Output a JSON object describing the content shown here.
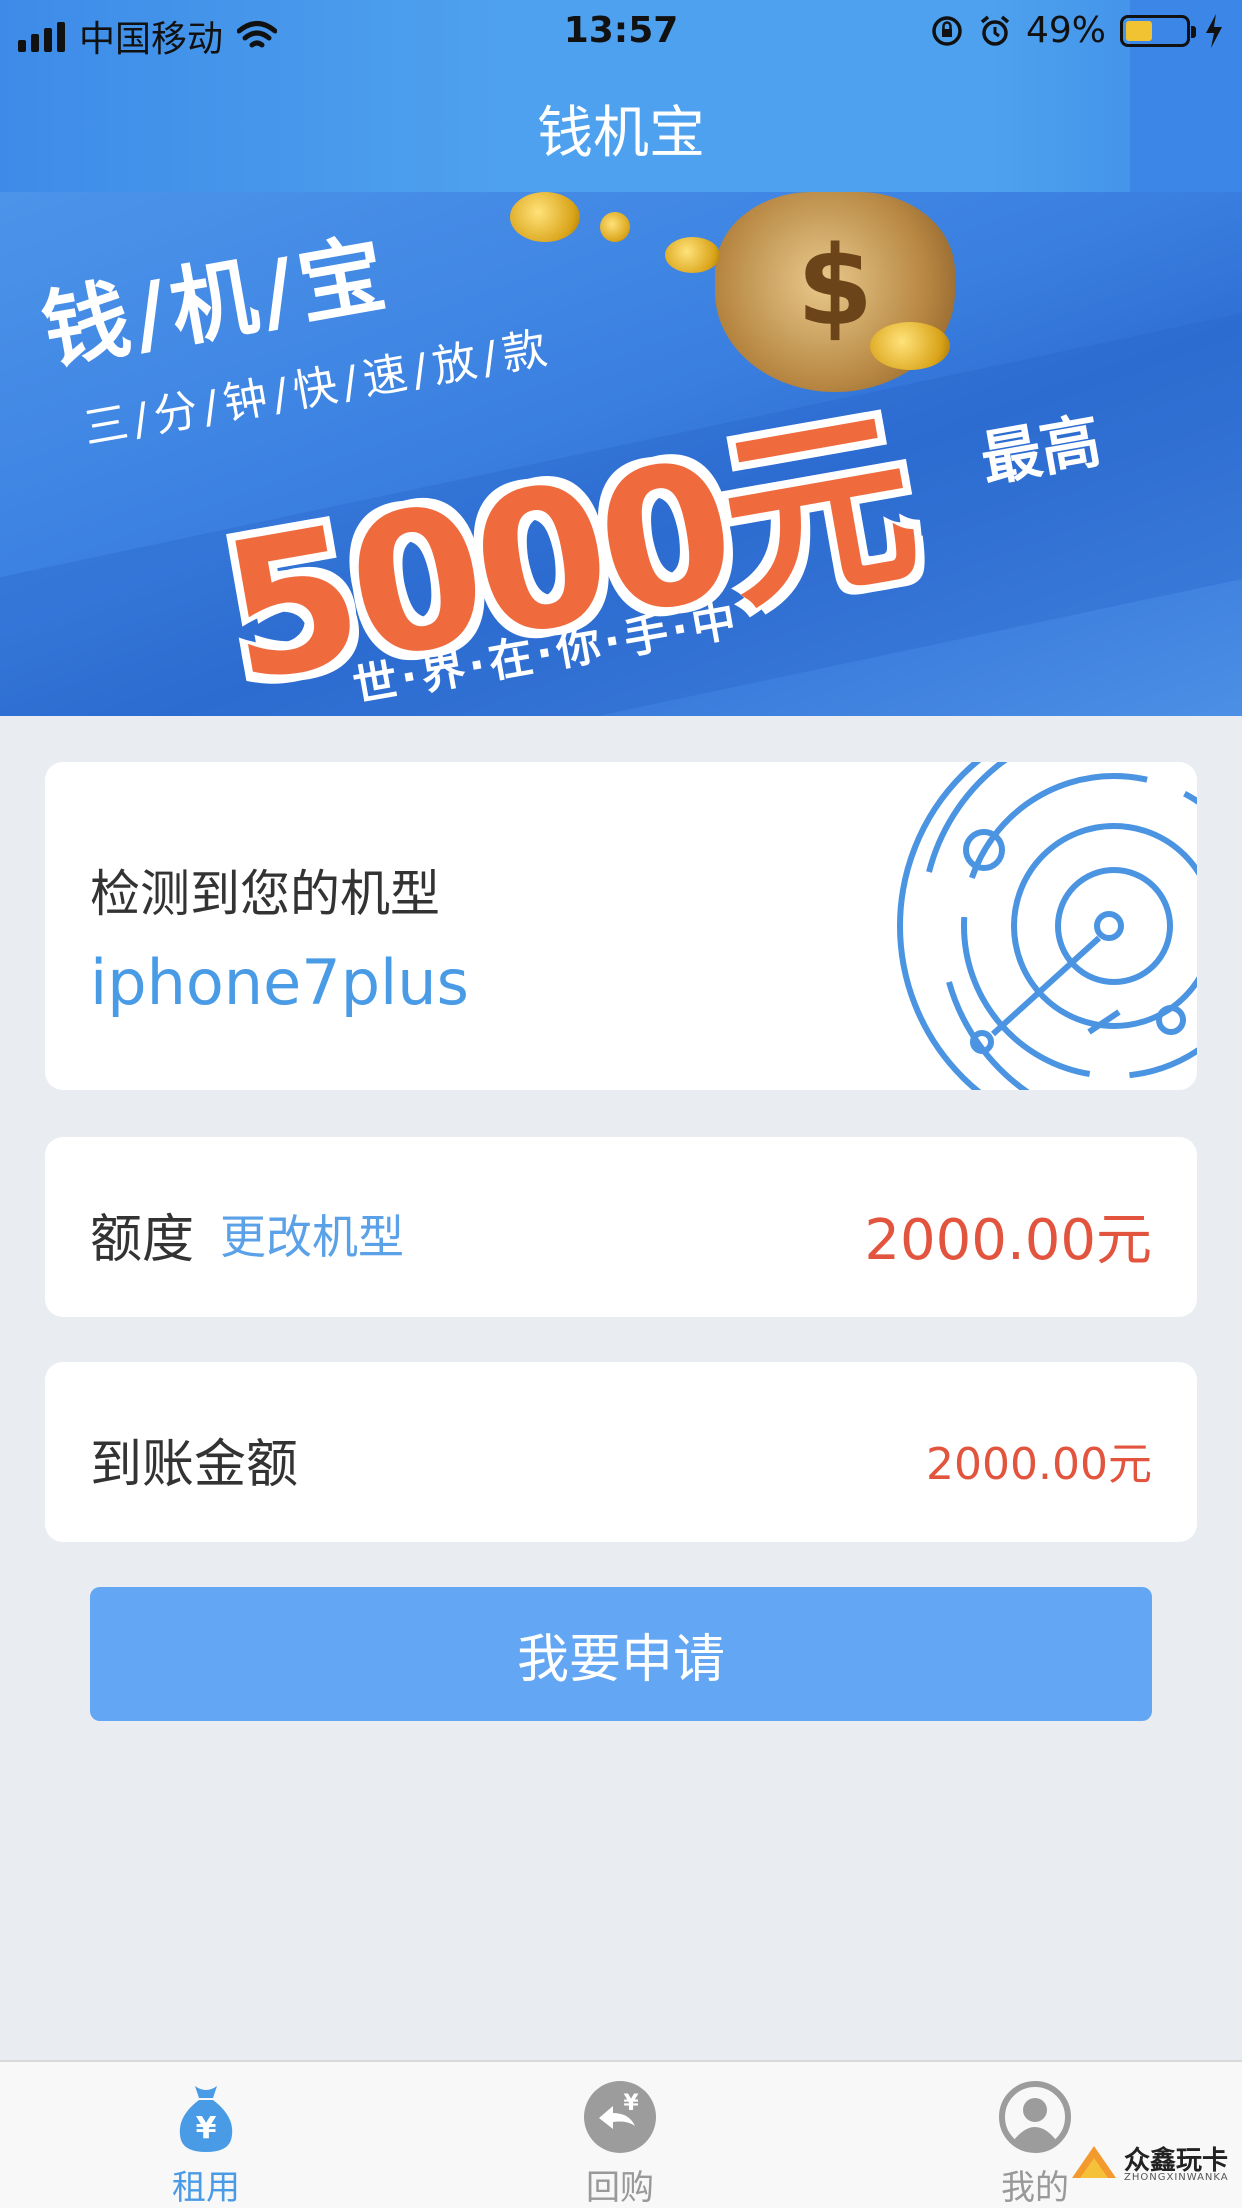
{
  "status_bar": {
    "carrier": "中国移动",
    "time": "13:57",
    "battery": "49%"
  },
  "nav": {
    "title": "钱机宝"
  },
  "banner": {
    "title": "钱/机/宝",
    "subtitle": "三/分/钟/快/速/放/款",
    "amount": "5000元",
    "amount_suffix": "最高",
    "slogan": "世·界·在·你·手·中"
  },
  "device_card": {
    "label": "检测到您的机型",
    "model": "iphone7plus"
  },
  "quota_card": {
    "label": "额度",
    "change_link": "更改机型",
    "amount": "2000.00元"
  },
  "arrival_card": {
    "label": "到账金额",
    "amount": "2000.00元"
  },
  "apply_button": "我要申请",
  "tabs": [
    {
      "label": "租用",
      "icon": "money-bag-icon",
      "active": true
    },
    {
      "label": "回购",
      "icon": "buyback-icon",
      "active": false
    },
    {
      "label": "我的",
      "icon": "user-icon",
      "active": false
    }
  ],
  "watermark": {
    "text": "众鑫玩卡",
    "sub": "ZHONGXINWANKA"
  },
  "colors": {
    "primary": "#4a9be6",
    "accent": "#e2543d",
    "button": "#63a6f4"
  }
}
